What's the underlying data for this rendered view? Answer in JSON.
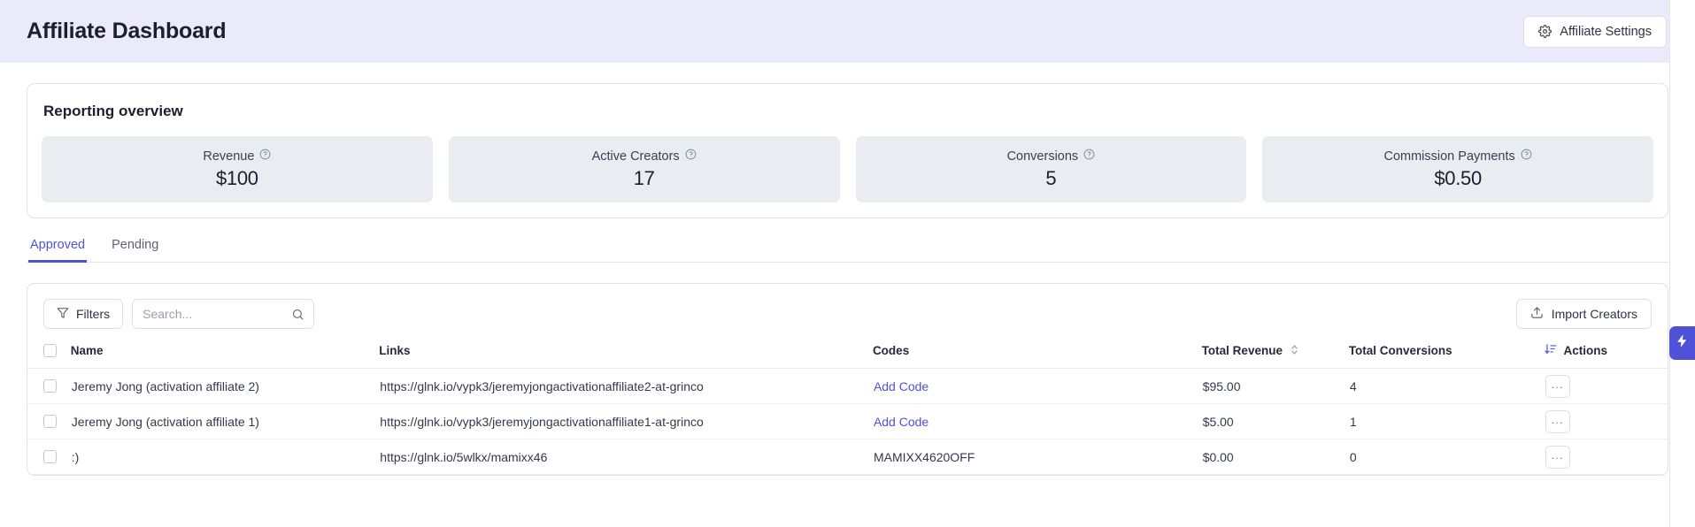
{
  "header": {
    "title": "Affiliate Dashboard",
    "settings_button": "Affiliate Settings",
    "settings_icon": "gear-icon",
    "background": "#eaeafb"
  },
  "reporting": {
    "title": "Reporting overview",
    "stats": [
      {
        "label": "Revenue",
        "value": "$100",
        "info_icon": "help-circle-icon"
      },
      {
        "label": "Active Creators",
        "value": "17",
        "info_icon": "help-circle-icon"
      },
      {
        "label": "Conversions",
        "value": "5",
        "info_icon": "help-circle-icon"
      },
      {
        "label": "Commission Payments",
        "value": "$0.50",
        "info_icon": "help-circle-icon"
      }
    ]
  },
  "tabs": [
    {
      "label": "Approved",
      "active": true
    },
    {
      "label": "Pending",
      "active": false
    }
  ],
  "toolbar": {
    "filters_label": "Filters",
    "filters_icon": "funnel-icon",
    "search_placeholder": "Search...",
    "search_value": "",
    "search_icon": "search-icon",
    "import_label": "Import Creators",
    "import_icon": "upload-icon"
  },
  "table": {
    "columns": [
      {
        "key": "check",
        "label": ""
      },
      {
        "key": "name",
        "label": "Name"
      },
      {
        "key": "links",
        "label": "Links"
      },
      {
        "key": "codes",
        "label": "Codes"
      },
      {
        "key": "revenue",
        "label": "Total Revenue",
        "sort_icon": "sort-updown-icon",
        "sort_state": "none"
      },
      {
        "key": "conversions",
        "label": "Total Conversions",
        "sort_icon": "sort-descending-icon",
        "sort_state": "desc"
      },
      {
        "key": "actions",
        "label": "Actions"
      }
    ],
    "rows": [
      {
        "name": "Jeremy Jong (activation affiliate 2)",
        "link": "https://glnk.io/vypk3/jeremyjongactivationaffiliate2-at-grinco",
        "code": "Add Code",
        "code_is_link": true,
        "revenue": "$95.00",
        "conversions": "4",
        "actions": "..."
      },
      {
        "name": "Jeremy Jong (activation affiliate 1)",
        "link": "https://glnk.io/vypk3/jeremyjongactivationaffiliate1-at-grinco",
        "code": "Add Code",
        "code_is_link": true,
        "revenue": "$5.00",
        "conversions": "1",
        "actions": "..."
      },
      {
        "name": ":)",
        "link": "https://glnk.io/5wlkx/mamixx46",
        "code": "MAMIXX4620OFF",
        "code_is_link": false,
        "revenue": "$0.00",
        "conversions": "0",
        "actions": "..."
      }
    ]
  },
  "right_rail": {
    "fab_icon": "lightning-bolt-icon",
    "fab_color": "#4f52d8"
  },
  "colors": {
    "accent": "#4f52d8",
    "header_bg": "#eaeafb",
    "tile_bg": "#e9edf1",
    "border": "#dfe2e8"
  }
}
